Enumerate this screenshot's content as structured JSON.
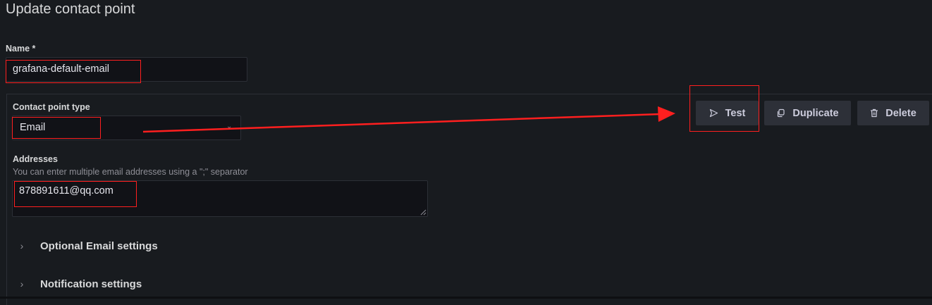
{
  "page": {
    "title": "Update contact point"
  },
  "form": {
    "name_label": "Name *",
    "name_value": "grafana-default-email"
  },
  "integration": {
    "type_label": "Contact point type",
    "type_value": "Email",
    "addresses_label": "Addresses",
    "addresses_help": "You can enter multiple email addresses using a \";\" separator",
    "addresses_value": "878891611@qq.com"
  },
  "actions": {
    "test_label": "Test",
    "duplicate_label": "Duplicate",
    "delete_label": "Delete"
  },
  "sections": {
    "optional_label": "Optional Email settings",
    "notification_label": "Notification settings"
  },
  "annotation": {
    "color": "#ff1f1f"
  },
  "theme": {
    "background": "#181b1f",
    "input_background": "#111217",
    "button_background": "#2d3038",
    "text_primary": "#d8d9da",
    "text_secondary": "#8e8e96"
  }
}
